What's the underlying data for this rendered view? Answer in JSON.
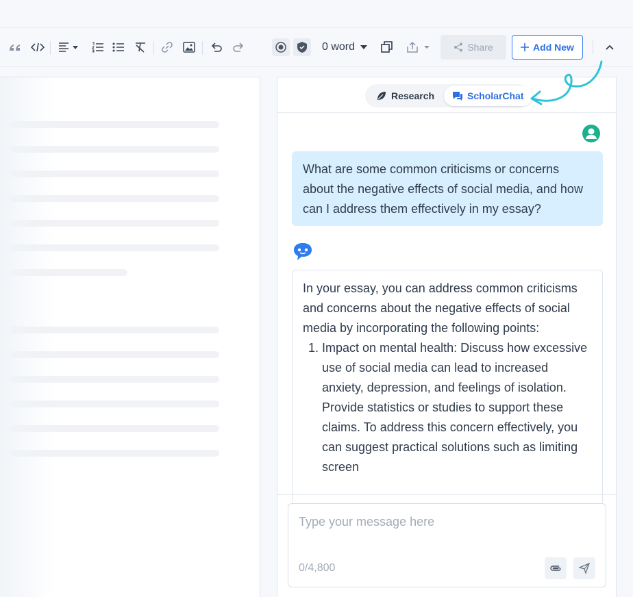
{
  "toolbar": {
    "icons": [
      "quote-icon",
      "code-icon",
      "align-left-icon",
      "ordered-list-icon",
      "bullet-list-icon",
      "clear-format-icon",
      "link-icon",
      "image-icon",
      "undo-icon",
      "redo-icon",
      "plagiarism-icon",
      "shield-icon",
      "copy-icon",
      "export-icon",
      "chevron-up-icon"
    ],
    "word_count": "0 word",
    "share_label": "Share",
    "add_new_label": "Add New"
  },
  "chat": {
    "tabs": [
      {
        "label": "Research",
        "active": false
      },
      {
        "label": "ScholarChat",
        "active": true
      }
    ],
    "user_message": "What are some common criticisms or concerns about the negative effects of social media, and how can I address them effectively in my essay?",
    "bot_intro": "In your essay, you can address common criticisms and concerns about the negative effects of social media by incorporating the following points:",
    "bot_points": [
      "Impact on mental health: Discuss how excessive use of social media can lead to increased anxiety, depression, and feelings of isolation. Provide statistics or studies to support these claims. To address this concern effectively, you can suggest practical solutions such as limiting screen"
    ],
    "composer": {
      "placeholder": "Type your message here",
      "char_count": "0/4,800"
    }
  },
  "colors": {
    "accent": "#2f6fe4",
    "user_bubble": "#d8efff",
    "avatar": "#1cb08d",
    "decor_arrow": "#2cc3d8"
  }
}
